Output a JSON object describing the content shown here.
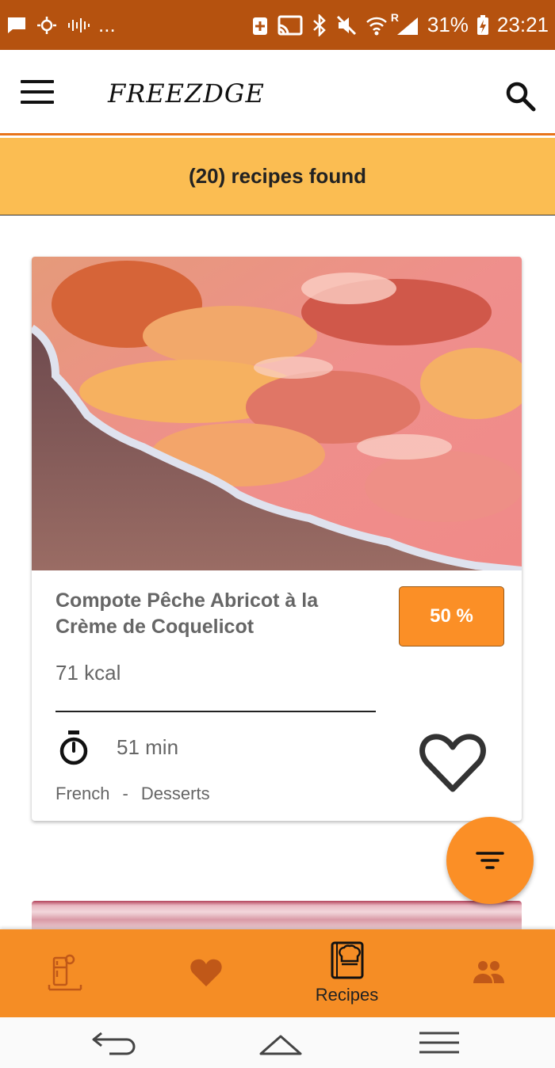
{
  "status_bar": {
    "left_ellipsis": "...",
    "roaming": "R",
    "battery": "31%",
    "time": "23:21"
  },
  "app_bar": {
    "title": "FREEZDGE"
  },
  "results_banner": {
    "text": "(20) recipes found"
  },
  "recipe": {
    "name": "Compote Pêche Abricot à la Crème de Coquelicot",
    "match": "50 %",
    "calories": "71 kcal",
    "duration": "51 min",
    "cuisine": "French",
    "separator": "-",
    "category": "Desserts"
  },
  "bottom_nav": {
    "items": [
      {
        "icon": "fridge-icon",
        "label": ""
      },
      {
        "icon": "heart-icon",
        "label": ""
      },
      {
        "icon": "recipe-book-icon",
        "label": "Recipes"
      },
      {
        "icon": "people-icon",
        "label": ""
      }
    ],
    "active_index": 2
  },
  "colors": {
    "status_bar": "#b5520f",
    "accent": "#f58d25",
    "banner": "#fbbd52",
    "text_muted": "#666666"
  }
}
